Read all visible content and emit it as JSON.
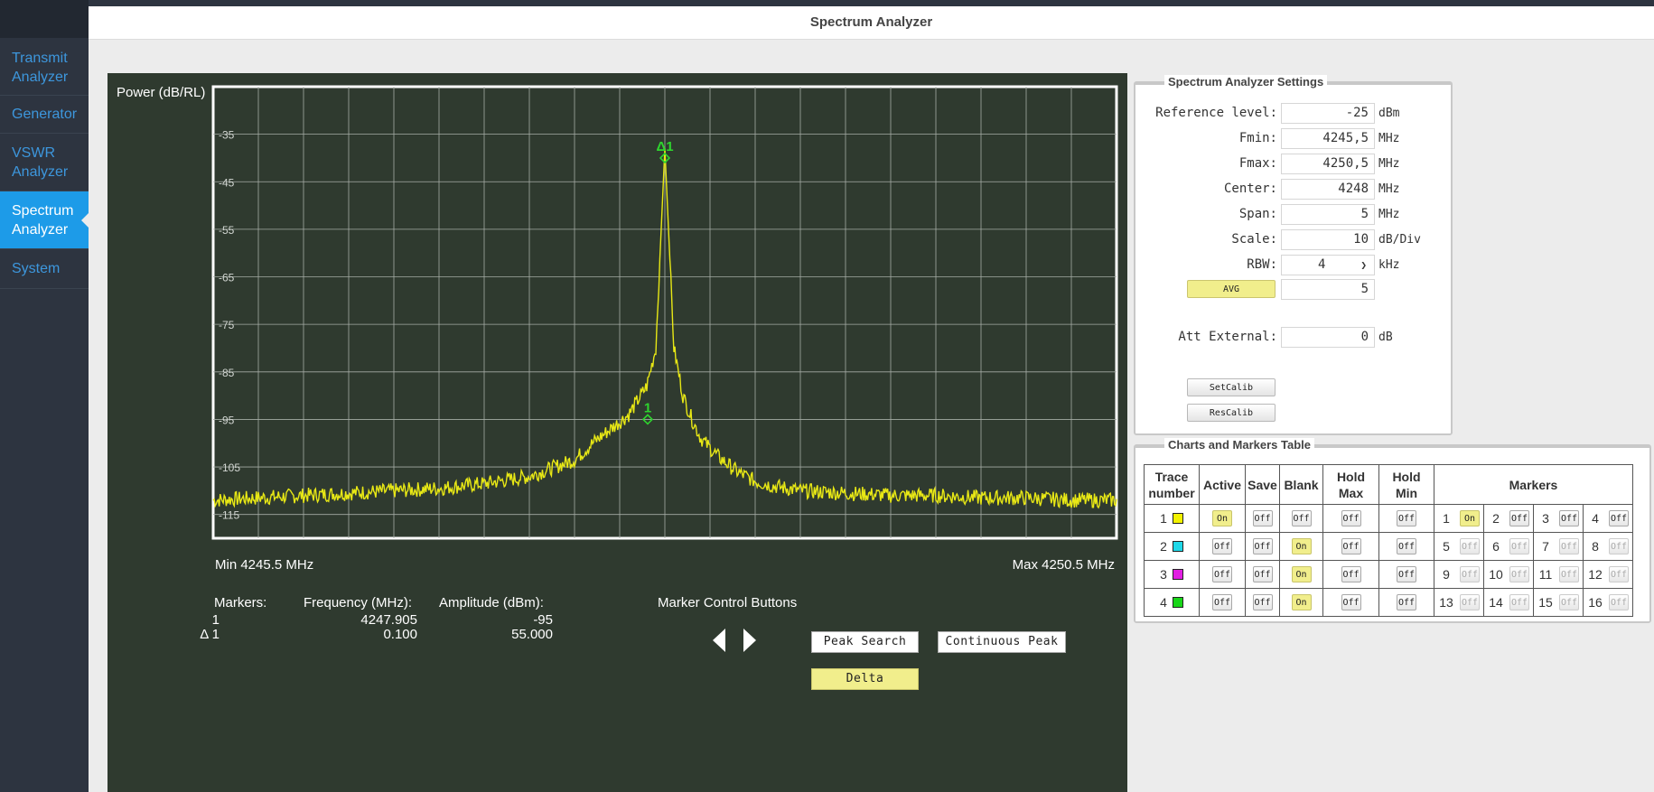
{
  "header": {
    "title": "Spectrum Analyzer"
  },
  "sidebar": {
    "items": [
      {
        "label": "Transmit Analyzer",
        "active": false
      },
      {
        "label": "Generator",
        "active": false
      },
      {
        "label": "VSWR Analyzer",
        "active": false
      },
      {
        "label": "Spectrum Analyzer",
        "active": true
      },
      {
        "label": "System",
        "active": false
      }
    ]
  },
  "chart_data": {
    "type": "line",
    "ylabel": "Power (dB/RL)",
    "xlim": [
      4245.5,
      4250.5
    ],
    "ylim": [
      -120,
      -25
    ],
    "x_ticks": [
      4245.5,
      4245.75,
      4246.0,
      4246.25,
      4246.5,
      4246.75,
      4247.0,
      4247.25,
      4247.5,
      4247.75,
      4248.0,
      4248.25,
      4248.5,
      4248.75,
      4249.0,
      4249.25,
      4249.5,
      4249.75,
      4250.0,
      4250.25,
      4250.5
    ],
    "y_ticks": [
      -35,
      -45,
      -55,
      -65,
      -75,
      -85,
      -95,
      -105,
      -115
    ],
    "grid": true,
    "min_label": "Min 4245.5 MHz",
    "max_label": "Max 4250.5 MHz",
    "series": [
      {
        "color": "#e8e815",
        "x": [
          4245.5,
          4245.75,
          4246.0,
          4246.25,
          4246.5,
          4246.75,
          4247.0,
          4247.25,
          4247.5,
          4247.6,
          4247.7,
          4247.8,
          4247.9,
          4247.95,
          4248.0,
          4248.05,
          4248.1,
          4248.15,
          4248.2,
          4248.3,
          4248.4,
          4248.5,
          4248.6,
          4248.75,
          4249.0,
          4249.25,
          4249.5,
          4249.75,
          4250.0,
          4250.25,
          4250.5
        ],
        "y": [
          -112,
          -111.5,
          -111,
          -110.5,
          -110,
          -109.5,
          -108.5,
          -107,
          -103.5,
          -100,
          -97,
          -94,
          -88,
          -80,
          -38,
          -80,
          -90,
          -95,
          -99,
          -103,
          -106,
          -108,
          -109,
          -110,
          -110.5,
          -111,
          -111,
          -111.5,
          -111.5,
          -112,
          -112
        ]
      }
    ],
    "markers": [
      {
        "label": "1",
        "x": 4247.905,
        "y": -95
      },
      {
        "label": "Δ1",
        "x": 4248.0,
        "y": -40
      }
    ]
  },
  "marker_readout": {
    "col_markers": "Markers:",
    "col_freq": "Frequency (MHz):",
    "col_amp": "Amplitude (dBm):",
    "rows": [
      {
        "name": "1",
        "freq": "4247.905",
        "amp": "-95"
      },
      {
        "name": "Δ 1",
        "freq": "0.100",
        "amp": "55.000"
      }
    ]
  },
  "controls": {
    "title": "Marker Control Buttons",
    "peak_search": "Peak Search",
    "continuous_peak": "Continuous Peak",
    "delta": "Delta"
  },
  "settings": {
    "legend": "Spectrum Analyzer Settings",
    "reference_level": {
      "label": "Reference level:",
      "value": "-25",
      "unit": "dBm"
    },
    "fmin": {
      "label": "Fmin:",
      "value": "4245,5",
      "unit": "MHz"
    },
    "fmax": {
      "label": "Fmax:",
      "value": "4250,5",
      "unit": "MHz"
    },
    "center": {
      "label": "Center:",
      "value": "4248",
      "unit": "MHz"
    },
    "span": {
      "label": "Span:",
      "value": "5",
      "unit": "MHz"
    },
    "scale": {
      "label": "Scale:",
      "value": "10",
      "unit": "dB/Div"
    },
    "rbw": {
      "label": "RBW:",
      "value": "4",
      "unit": "kHz"
    },
    "avg": {
      "label": "AVG",
      "value": "5"
    },
    "att_external": {
      "label": "Att External:",
      "value": "0",
      "unit": "dB"
    },
    "setcalib": "SetCalib",
    "rescalib": "ResCalib"
  },
  "charts_table": {
    "legend": "Charts and Markers Table",
    "headers": {
      "trace_line1": "Trace",
      "trace_line2": "number",
      "active": "Active",
      "save": "Save",
      "blank": "Blank",
      "holdmax_line1": "Hold",
      "holdmax_line2": "Max",
      "holdmin_line1": "Hold",
      "holdmin_line2": "Min",
      "markers": "Markers"
    },
    "rows": [
      {
        "trace": "1",
        "color": "#f2f200",
        "active": "On",
        "save": "Off",
        "blank": "Off",
        "hold_max": "Off",
        "hold_min": "Off",
        "markers": [
          {
            "n": "1",
            "state": "On"
          },
          {
            "n": "2",
            "state": "Off"
          },
          {
            "n": "3",
            "state": "Off"
          },
          {
            "n": "4",
            "state": "Off"
          }
        ]
      },
      {
        "trace": "2",
        "color": "#1fd8e8",
        "active": "Off",
        "save": "Off",
        "blank": "On",
        "hold_max": "Off",
        "hold_min": "Off",
        "markers": [
          {
            "n": "5",
            "state": "Off"
          },
          {
            "n": "6",
            "state": "Off"
          },
          {
            "n": "7",
            "state": "Off"
          },
          {
            "n": "8",
            "state": "Off"
          }
        ]
      },
      {
        "trace": "3",
        "color": "#e21fe2",
        "active": "Off",
        "save": "Off",
        "blank": "On",
        "hold_max": "Off",
        "hold_min": "Off",
        "markers": [
          {
            "n": "9",
            "state": "Off"
          },
          {
            "n": "10",
            "state": "Off"
          },
          {
            "n": "11",
            "state": "Off"
          },
          {
            "n": "12",
            "state": "Off"
          }
        ]
      },
      {
        "trace": "4",
        "color": "#19d619",
        "active": "Off",
        "save": "Off",
        "blank": "On",
        "hold_max": "Off",
        "hold_min": "Off",
        "markers": [
          {
            "n": "13",
            "state": "Off"
          },
          {
            "n": "14",
            "state": "Off"
          },
          {
            "n": "15",
            "state": "Off"
          },
          {
            "n": "16",
            "state": "Off"
          }
        ]
      }
    ]
  }
}
